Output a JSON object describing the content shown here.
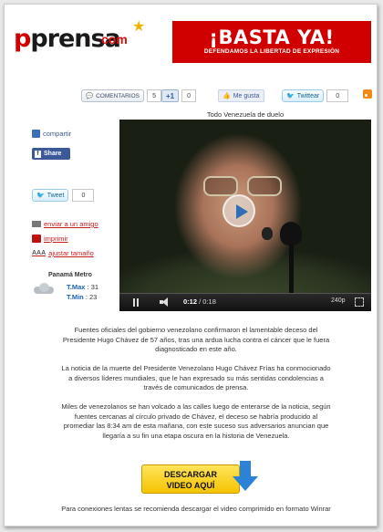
{
  "header": {
    "logo_main": "prensa",
    "logo_com": "com",
    "banner_title": "¡BASTA YA!",
    "banner_sub": "DEFENDAMOS LA LIBERTAD DE EXPRESIÓN"
  },
  "social": {
    "comments_label": "COMENTARIOS",
    "comments_count": "5",
    "gplus_label": "+1",
    "gplus_count": "0",
    "like_label": "Me gusta",
    "twitter_label": "Twittear",
    "twitter_count": "0"
  },
  "caption": "Todo Venezuela de duelo",
  "sidebar": {
    "share_label": "compartir",
    "fb_share_label": "Share",
    "tweet_label": "Tweet",
    "tweet_count": "0",
    "email_label": "enviar a un amigo",
    "print_label": "imprimir",
    "resize_icon_text": "AAA",
    "resize_label": "ajustar tamaño",
    "weather": {
      "title": "Panamá Metro",
      "max_label": "T.Max",
      "max_value": ": 31",
      "min_label": "T.Min",
      "min_value": ": 23"
    }
  },
  "video": {
    "current_time": "0:12",
    "total_time": " / 0:18",
    "quality": "240p"
  },
  "article": {
    "p1": "Fuentes oficiales del gobierno venezolano confirmaron el lamentable deceso del Presidente Hugo Chávez de 57 años, tras una ardua lucha contra el cáncer que le fuera diagnosticado en este año.",
    "p2": "La noticia de la muerte del Presidente Venezolano Hugo Chávez Frías ha conmocionado a diversos líderes mundiales, que le han expresado su más sentidas condolencias a través de comunicados de prensa.",
    "p3": "Miles de venezolanos se han volcado a las calles luego de enterarse de la noticia, según fuentes cercanas al círculo privado de Chávez, el deceso se habría producido al promediar las 8:34 am de esta mañana, con este suceso sus adversarios anuncian que llegaría a su fin una etapa oscura en la historia de Venezuela."
  },
  "download": {
    "line1": "DESCARGAR",
    "line2": "VIDEO AQUÍ",
    "note": "Para conexiones lentas se recomienda descargar el video comprimido en formato Winrar"
  }
}
